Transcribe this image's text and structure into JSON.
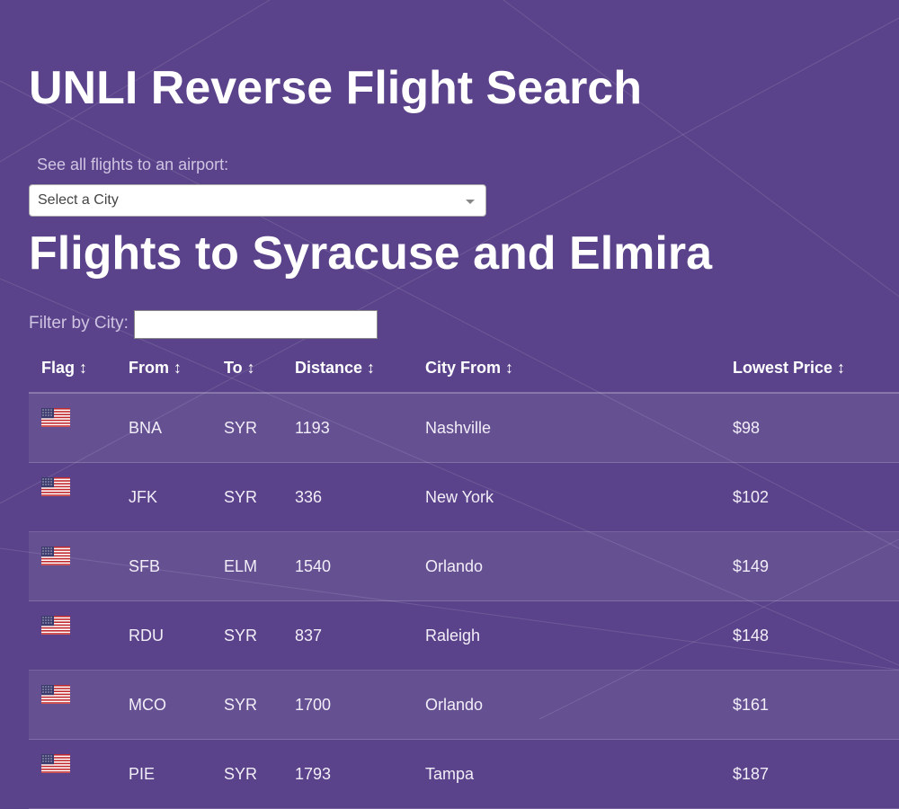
{
  "page": {
    "title": "UNLI Reverse Flight Search",
    "airport_label": "See all flights to an airport:",
    "city_select_value": "Select a City",
    "section_title": "Flights to Syracuse and Elmira",
    "filter_label": "Filter by City:",
    "filter_value": ""
  },
  "colors": {
    "background": "#5a438a",
    "text": "#ffffff",
    "muted_label": "#cfc4e2"
  },
  "table": {
    "headers": [
      "Flag ↕",
      "From ↕",
      "To ↕",
      "Distance ↕",
      "City From ↕",
      "Lowest Price ↕"
    ],
    "rows": [
      {
        "flag": "us-flag-icon",
        "from": "BNA",
        "to": "SYR",
        "distance": "1193",
        "city_from": "Nashville",
        "price": "$98"
      },
      {
        "flag": "us-flag-icon",
        "from": "JFK",
        "to": "SYR",
        "distance": "336",
        "city_from": "New York",
        "price": "$102"
      },
      {
        "flag": "us-flag-icon",
        "from": "SFB",
        "to": "ELM",
        "distance": "1540",
        "city_from": "Orlando",
        "price": "$149"
      },
      {
        "flag": "us-flag-icon",
        "from": "RDU",
        "to": "SYR",
        "distance": "837",
        "city_from": "Raleigh",
        "price": "$148"
      },
      {
        "flag": "us-flag-icon",
        "from": "MCO",
        "to": "SYR",
        "distance": "1700",
        "city_from": "Orlando",
        "price": "$161"
      },
      {
        "flag": "us-flag-icon",
        "from": "PIE",
        "to": "SYR",
        "distance": "1793",
        "city_from": "Tampa",
        "price": "$187"
      }
    ]
  }
}
